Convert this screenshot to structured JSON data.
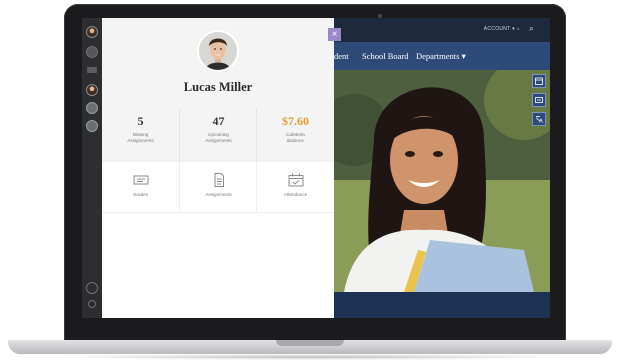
{
  "profile": {
    "name": "Lucas Miller",
    "close_label": "×"
  },
  "stats": [
    {
      "value": "5",
      "label_line1": "Missing",
      "label_line2": "Assignments"
    },
    {
      "value": "47",
      "label_line1": "Upcoming",
      "label_line2": "Assignments"
    },
    {
      "value": "$7.60",
      "label_line1": "Cafeteria",
      "label_line2": "Balance"
    }
  ],
  "tiles": [
    {
      "label": "Grades",
      "icon": "grades-icon"
    },
    {
      "label": "Assignments",
      "icon": "assignments-icon"
    },
    {
      "label": "Attendance",
      "icon": "attendance-icon"
    }
  ],
  "site": {
    "account_label": "ACCOUNT ▾ ⌂",
    "search_icon": "search-icon",
    "nav": [
      "dent",
      "School Board",
      "Departments ▾"
    ]
  },
  "colors": {
    "accent_money": "#e39a2d",
    "nav_blue": "#2d4a78",
    "close_purple": "#9a88c8"
  }
}
